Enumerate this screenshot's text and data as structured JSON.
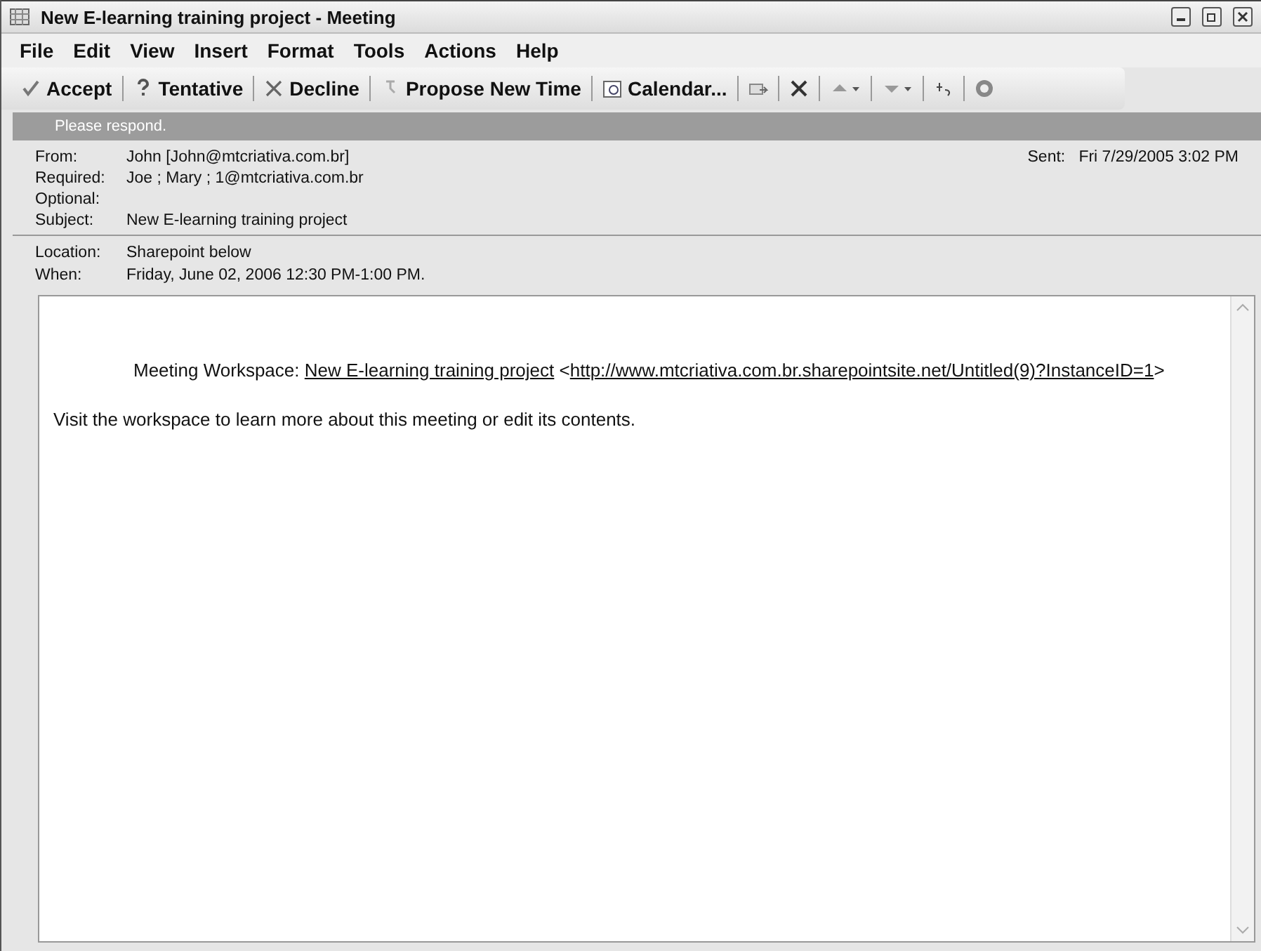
{
  "window": {
    "title": "New E-learning training project - Meeting"
  },
  "menu": [
    "File",
    "Edit",
    "View",
    "Insert",
    "Format",
    "Tools",
    "Actions",
    "Help"
  ],
  "toolbar": [
    {
      "kind": "text",
      "label": "Accept"
    },
    {
      "kind": "text",
      "label": "Tentative"
    },
    {
      "kind": "text",
      "label": "Decline"
    },
    {
      "kind": "text",
      "label": "Propose New Time"
    },
    {
      "kind": "text",
      "label": "Calendar..."
    },
    {
      "kind": "icon"
    },
    {
      "kind": "icon"
    },
    {
      "kind": "icon"
    },
    {
      "kind": "icon"
    },
    {
      "kind": "icon"
    },
    {
      "kind": "icon"
    }
  ],
  "info_bar": "Please respond.",
  "header": [
    {
      "label": "From:",
      "value": "John  [John@mtcriativa.com.br]"
    },
    {
      "label": "Required:",
      "value": "Joe  ; Mary ; 1@mtcriativa.com.br"
    },
    {
      "label": "Optional:"
    },
    {
      "label": "Subject:",
      "value": "New E-learning training project"
    }
  ],
  "sent": {
    "label": "Sent:",
    "value": "Fri 7/29/2005 3:02 PM"
  },
  "details": [
    {
      "label": "Location:",
      "value": "Sharepoint below"
    },
    {
      "label": "When:",
      "value": "Friday, June 02, 2006 12:30 PM-1:00 PM."
    }
  ],
  "body": {
    "workspace_label": "Meeting Workspace:",
    "workspace_link": "New E-learning training project",
    "url_open": "<",
    "url_close": ">",
    "url": "http://www.mtcriativa.com.br.sharepointsite.net/Untitled(9)?InstanceID=1",
    "visit_text": "Visit the workspace to learn more about this meeting or edit its contents."
  }
}
